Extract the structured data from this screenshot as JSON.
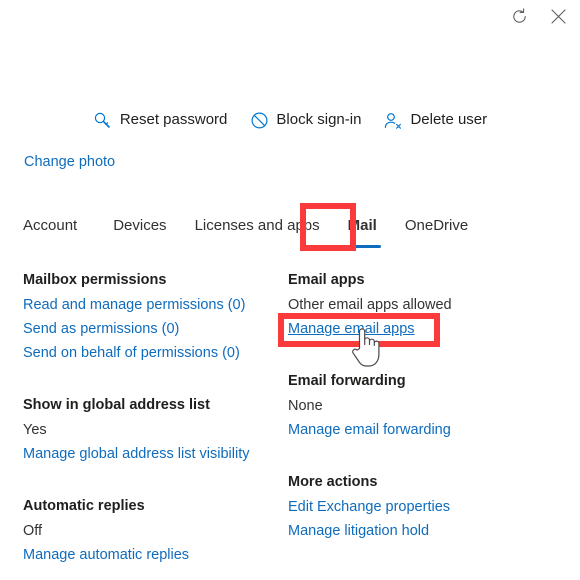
{
  "window": {
    "refresh_icon": "refresh-icon",
    "close_icon": "close-icon"
  },
  "command_bar": {
    "commands": [
      {
        "label": "Reset password",
        "icon": "key-icon"
      },
      {
        "label": "Block sign-in",
        "icon": "block-icon"
      },
      {
        "label": "Delete user",
        "icon": "person-delete-icon"
      }
    ]
  },
  "profile": {
    "change_photo_label": "Change photo"
  },
  "tabs": {
    "items": [
      {
        "label": "Account",
        "selected": false
      },
      {
        "label": "Devices",
        "selected": false
      },
      {
        "label": "Licenses and apps",
        "selected": false
      },
      {
        "label": "Mail",
        "selected": true
      },
      {
        "label": "OneDrive",
        "selected": false
      }
    ]
  },
  "mail": {
    "left_groups": [
      {
        "title": "Mailbox permissions",
        "links": [
          "Read and manage permissions (0)",
          "Send as permissions (0)",
          "Send on behalf of permissions (0)"
        ]
      },
      {
        "title": "Show in global address list",
        "value": "Yes",
        "links": [
          "Manage global address list visibility"
        ]
      },
      {
        "title": "Automatic replies",
        "value": "Off",
        "links": [
          "Manage automatic replies"
        ]
      }
    ],
    "right_groups": [
      {
        "title": "Email apps",
        "value": "Other email apps allowed",
        "links": [
          "Manage email apps"
        ]
      },
      {
        "title": "Email forwarding",
        "value": "None",
        "links": [
          "Manage email forwarding"
        ]
      },
      {
        "title": "More actions",
        "links": [
          "Edit Exchange properties",
          "Manage litigation hold"
        ]
      }
    ]
  },
  "annotations": {
    "highlight_color": "#fb3b3b",
    "highlighted_tab": "Mail",
    "highlighted_link": "Manage email apps",
    "cursor": "pointing-hand-cursor"
  },
  "theme": {
    "link_color": "#0f6cbd",
    "accent_color": "#0078d4",
    "text_color": "#323130"
  }
}
